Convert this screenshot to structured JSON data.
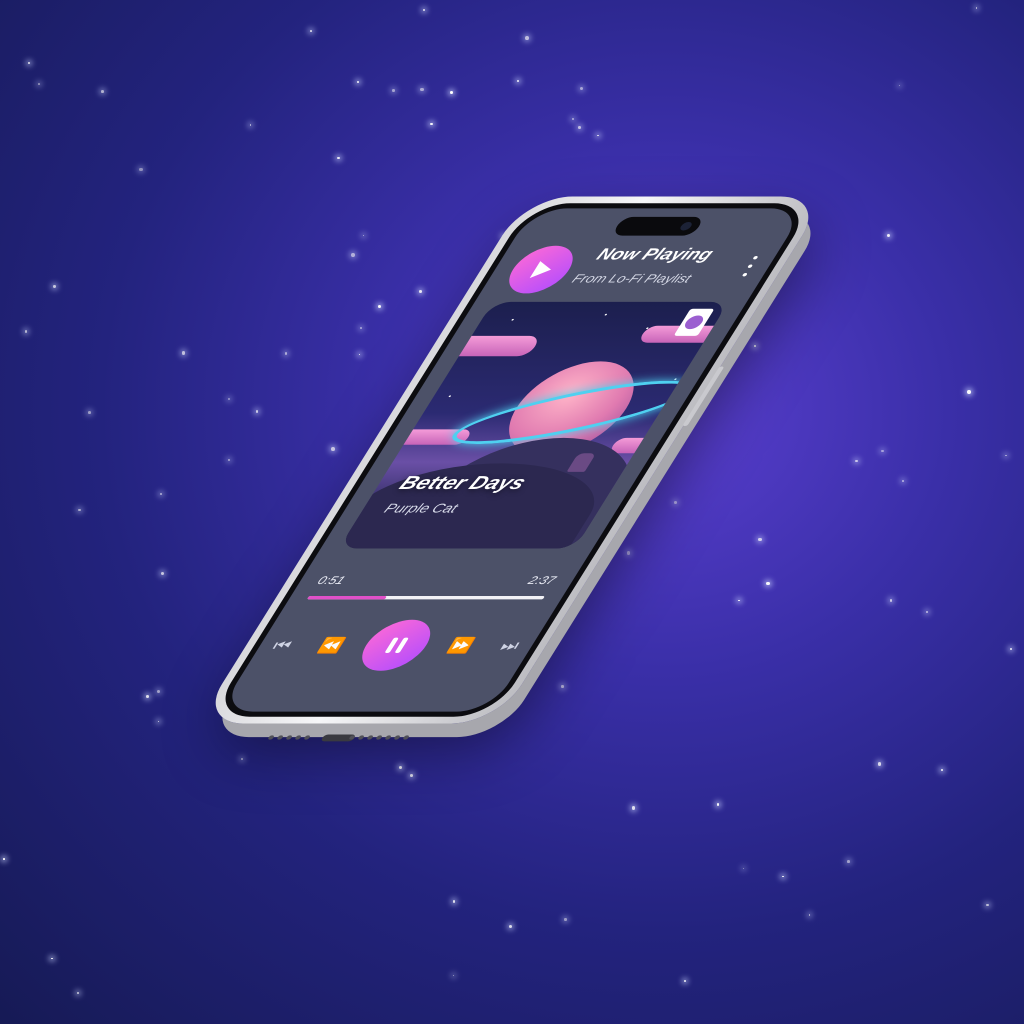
{
  "player": {
    "title": "Now Playing",
    "subtitle": "From Lo-Fi Playlist",
    "song_title": "Better Days",
    "artist": "Purple Cat",
    "time_current": "0:51",
    "time_total": "2:37",
    "progress_fraction": 0.33
  },
  "colors": {
    "accent": "#e050c8",
    "screen_bg": "#4c5168",
    "sky": "#2b2a72"
  },
  "icons": {
    "logo": "play-icon",
    "menu": "more-vertical-icon",
    "prev": "skip-previous-icon",
    "rewind": "rewind-icon",
    "pause": "pause-icon",
    "forward": "fast-forward-icon",
    "next": "skip-next-icon"
  }
}
